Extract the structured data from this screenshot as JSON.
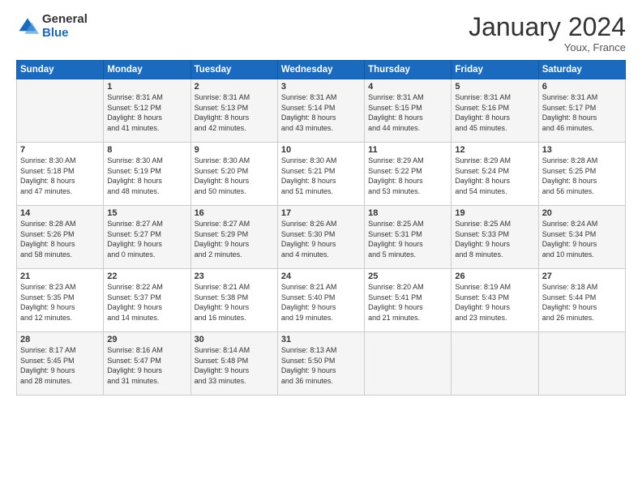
{
  "header": {
    "logo_general": "General",
    "logo_blue": "Blue",
    "title": "January 2024",
    "location": "Youx, France"
  },
  "days_of_week": [
    "Sunday",
    "Monday",
    "Tuesday",
    "Wednesday",
    "Thursday",
    "Friday",
    "Saturday"
  ],
  "weeks": [
    [
      {
        "day": "",
        "info": ""
      },
      {
        "day": "1",
        "info": "Sunrise: 8:31 AM\nSunset: 5:12 PM\nDaylight: 8 hours\nand 41 minutes."
      },
      {
        "day": "2",
        "info": "Sunrise: 8:31 AM\nSunset: 5:13 PM\nDaylight: 8 hours\nand 42 minutes."
      },
      {
        "day": "3",
        "info": "Sunrise: 8:31 AM\nSunset: 5:14 PM\nDaylight: 8 hours\nand 43 minutes."
      },
      {
        "day": "4",
        "info": "Sunrise: 8:31 AM\nSunset: 5:15 PM\nDaylight: 8 hours\nand 44 minutes."
      },
      {
        "day": "5",
        "info": "Sunrise: 8:31 AM\nSunset: 5:16 PM\nDaylight: 8 hours\nand 45 minutes."
      },
      {
        "day": "6",
        "info": "Sunrise: 8:31 AM\nSunset: 5:17 PM\nDaylight: 8 hours\nand 46 minutes."
      }
    ],
    [
      {
        "day": "7",
        "info": ""
      },
      {
        "day": "8",
        "info": "Sunrise: 8:30 AM\nSunset: 5:19 PM\nDaylight: 8 hours\nand 48 minutes."
      },
      {
        "day": "9",
        "info": "Sunrise: 8:30 AM\nSunset: 5:20 PM\nDaylight: 8 hours\nand 50 minutes."
      },
      {
        "day": "10",
        "info": "Sunrise: 8:30 AM\nSunset: 5:21 PM\nDaylight: 8 hours\nand 51 minutes."
      },
      {
        "day": "11",
        "info": "Sunrise: 8:29 AM\nSunset: 5:22 PM\nDaylight: 8 hours\nand 53 minutes."
      },
      {
        "day": "12",
        "info": "Sunrise: 8:29 AM\nSunset: 5:24 PM\nDaylight: 8 hours\nand 54 minutes."
      },
      {
        "day": "13",
        "info": "Sunrise: 8:28 AM\nSunset: 5:25 PM\nDaylight: 8 hours\nand 56 minutes."
      }
    ],
    [
      {
        "day": "14",
        "info": ""
      },
      {
        "day": "15",
        "info": "Sunrise: 8:27 AM\nSunset: 5:27 PM\nDaylight: 9 hours\nand 0 minutes."
      },
      {
        "day": "16",
        "info": "Sunrise: 8:27 AM\nSunset: 5:29 PM\nDaylight: 9 hours\nand 2 minutes."
      },
      {
        "day": "17",
        "info": "Sunrise: 8:26 AM\nSunset: 5:30 PM\nDaylight: 9 hours\nand 4 minutes."
      },
      {
        "day": "18",
        "info": "Sunrise: 8:25 AM\nSunset: 5:31 PM\nDaylight: 9 hours\nand 5 minutes."
      },
      {
        "day": "19",
        "info": "Sunrise: 8:25 AM\nSunset: 5:33 PM\nDaylight: 9 hours\nand 8 minutes."
      },
      {
        "day": "20",
        "info": "Sunrise: 8:24 AM\nSunset: 5:34 PM\nDaylight: 9 hours\nand 10 minutes."
      }
    ],
    [
      {
        "day": "21",
        "info": ""
      },
      {
        "day": "22",
        "info": "Sunrise: 8:22 AM\nSunset: 5:37 PM\nDaylight: 9 hours\nand 14 minutes."
      },
      {
        "day": "23",
        "info": "Sunrise: 8:21 AM\nSunset: 5:38 PM\nDaylight: 9 hours\nand 16 minutes."
      },
      {
        "day": "24",
        "info": "Sunrise: 8:21 AM\nSunset: 5:40 PM\nDaylight: 9 hours\nand 19 minutes."
      },
      {
        "day": "25",
        "info": "Sunrise: 8:20 AM\nSunset: 5:41 PM\nDaylight: 9 hours\nand 21 minutes."
      },
      {
        "day": "26",
        "info": "Sunrise: 8:19 AM\nSunset: 5:43 PM\nDaylight: 9 hours\nand 23 minutes."
      },
      {
        "day": "27",
        "info": "Sunrise: 8:18 AM\nSunset: 5:44 PM\nDaylight: 9 hours\nand 26 minutes."
      }
    ],
    [
      {
        "day": "28",
        "info": "Sunrise: 8:17 AM\nSunset: 5:45 PM\nDaylight: 9 hours\nand 28 minutes."
      },
      {
        "day": "29",
        "info": "Sunrise: 8:16 AM\nSunset: 5:47 PM\nDaylight: 9 hours\nand 31 minutes."
      },
      {
        "day": "30",
        "info": "Sunrise: 8:14 AM\nSunset: 5:48 PM\nDaylight: 9 hours\nand 33 minutes."
      },
      {
        "day": "31",
        "info": "Sunrise: 8:13 AM\nSunset: 5:50 PM\nDaylight: 9 hours\nand 36 minutes."
      },
      {
        "day": "",
        "info": ""
      },
      {
        "day": "",
        "info": ""
      },
      {
        "day": "",
        "info": ""
      }
    ]
  ],
  "week7_sunday": {
    "day": "7",
    "info": "Sunrise: 8:30 AM\nSunset: 5:18 PM\nDaylight: 8 hours\nand 47 minutes."
  },
  "week14_sunday": {
    "day": "14",
    "info": "Sunrise: 8:28 AM\nSunset: 5:26 PM\nDaylight: 8 hours\nand 58 minutes."
  },
  "week21_sunday": {
    "day": "21",
    "info": "Sunrise: 8:23 AM\nSunset: 5:35 PM\nDaylight: 9 hours\nand 12 minutes."
  }
}
